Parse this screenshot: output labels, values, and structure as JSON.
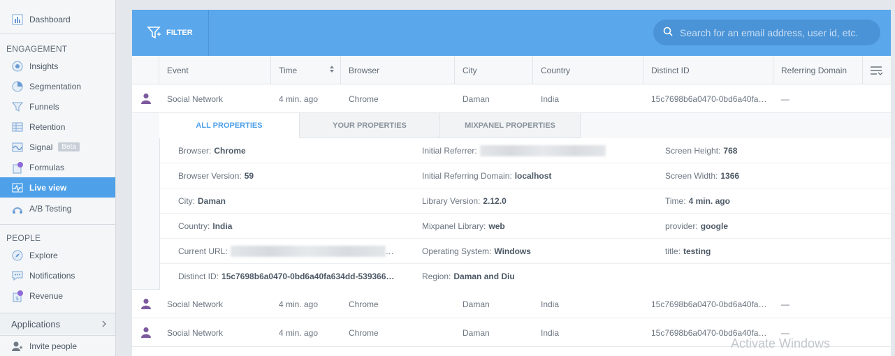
{
  "sidebar": {
    "dashboard": "Dashboard",
    "engagement_heading": "ENGAGEMENT",
    "insights": "Insights",
    "segmentation": "Segmentation",
    "funnels": "Funnels",
    "retention": "Retention",
    "signal": "Signal",
    "signal_badge": "Beta",
    "formulas": "Formulas",
    "live_view": "Live view",
    "ab_testing": "A/B Testing",
    "people_heading": "PEOPLE",
    "explore": "Explore",
    "notifications": "Notifications",
    "revenue": "Revenue",
    "applications": "Applications",
    "invite": "Invite people"
  },
  "toolbar": {
    "filter_label": "FILTER",
    "search_placeholder": "Search for an email address, user id, etc."
  },
  "table": {
    "columns": [
      "Event",
      "Time",
      "Browser",
      "City",
      "Country",
      "Distinct ID",
      "Referring Domain"
    ],
    "rows": [
      {
        "event": "Social Network",
        "time": "4 min. ago",
        "browser": "Chrome",
        "city": "Daman",
        "country": "India",
        "distinct_id": "15c7698b6a0470-0bd6a40fa…",
        "referring": "—"
      },
      {
        "event": "Social Network",
        "time": "4 min. ago",
        "browser": "Chrome",
        "city": "Daman",
        "country": "India",
        "distinct_id": "15c7698b6a0470-0bd6a40fa…",
        "referring": "—"
      },
      {
        "event": "Social Network",
        "time": "4 min. ago",
        "browser": "Chrome",
        "city": "Daman",
        "country": "India",
        "distinct_id": "15c7698b6a0470-0bd6a40fa…",
        "referring": "—"
      }
    ]
  },
  "detail": {
    "tabs": [
      "ALL PROPERTIES",
      "YOUR PROPERTIES",
      "MIXPANEL PROPERTIES"
    ],
    "props": [
      {
        "k": "Browser:",
        "v": "Chrome"
      },
      {
        "k": "Initial Referrer:",
        "v": ""
      },
      {
        "k": "Screen Height:",
        "v": "768"
      },
      {
        "k": "Browser Version:",
        "v": "59"
      },
      {
        "k": "Initial Referring Domain:",
        "v": "localhost"
      },
      {
        "k": "Screen Width:",
        "v": "1366"
      },
      {
        "k": "City:",
        "v": "Daman"
      },
      {
        "k": "Library Version:",
        "v": "2.12.0"
      },
      {
        "k": "Time:",
        "v": "4 min. ago"
      },
      {
        "k": "Country:",
        "v": "India"
      },
      {
        "k": "Mixpanel Library:",
        "v": "web"
      },
      {
        "k": "provider:",
        "v": "google"
      },
      {
        "k": "Current URL:",
        "v": "…"
      },
      {
        "k": "Operating System:",
        "v": "Windows"
      },
      {
        "k": "title:",
        "v": "testing"
      },
      {
        "k": "Distinct ID:",
        "v": "15c7698b6a0470-0bd6a40fa634dd-539366…"
      },
      {
        "k": "Region:",
        "v": "Daman and Diu"
      }
    ]
  },
  "watermark": "Activate Windows"
}
